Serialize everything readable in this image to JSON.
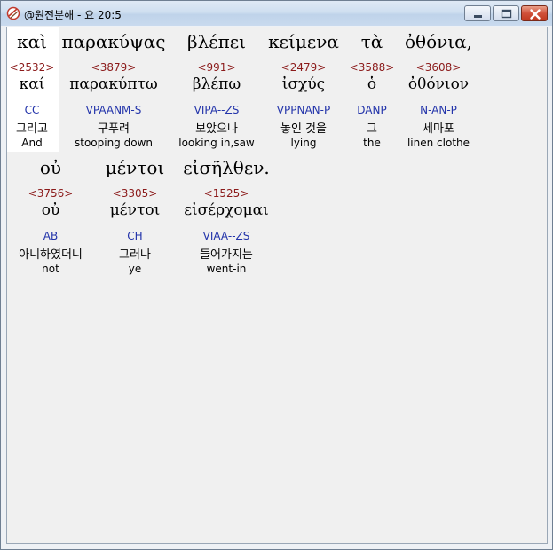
{
  "window": {
    "title": "@원전분해 - 요 20:5",
    "icon": "app-logo-icon",
    "controls": {
      "minimize": "minimize-icon",
      "maximize": "maximize-icon",
      "close": "close-icon"
    }
  },
  "colors": {
    "strongs": "#8b1a1a",
    "parsing": "#2233aa",
    "text": "#000000"
  },
  "words": [
    {
      "greek": "καὶ",
      "strongs": "<2532>",
      "lemma": "καί",
      "parsing": "CC",
      "korean": "그리고",
      "english": "And"
    },
    {
      "greek": "παρακύψας",
      "strongs": "<3879>",
      "lemma": "παρακύπτω",
      "parsing": "VPAANM-S",
      "korean": "구푸려",
      "english": "stooping down"
    },
    {
      "greek": "βλέπει",
      "strongs": "<991>",
      "lemma": "βλέπω",
      "parsing": "VIPA--ZS",
      "korean": "보았으나",
      "english": "looking in,saw"
    },
    {
      "greek": "κείμενα",
      "strongs": "<2479>",
      "lemma": "ἰσχύς",
      "parsing": "VPPNAN-P",
      "korean": "놓인 것을",
      "english": "lying"
    },
    {
      "greek": "τὰ",
      "strongs": "<3588>",
      "lemma": "ὁ",
      "parsing": "DANP",
      "korean": "그",
      "english": "the"
    },
    {
      "greek": "ὀθόνια,",
      "strongs": "<3608>",
      "lemma": "ὀθόνιον",
      "parsing": "N-AN-P",
      "korean": "세마포",
      "english": "linen clothe"
    },
    {
      "greek": "οὐ",
      "strongs": "<3756>",
      "lemma": "οὐ",
      "parsing": "AB",
      "korean": "아니하였더니",
      "english": "not"
    },
    {
      "greek": "μέντοι",
      "strongs": "<3305>",
      "lemma": "μέντοι",
      "parsing": "CH",
      "korean": "그러나",
      "english": "ye"
    },
    {
      "greek": "εἰσῆλθεν.",
      "strongs": "<1525>",
      "lemma": "εἰσέρχομαι",
      "parsing": "VIAA--ZS",
      "korean": "들어가지는",
      "english": "went-in"
    }
  ]
}
